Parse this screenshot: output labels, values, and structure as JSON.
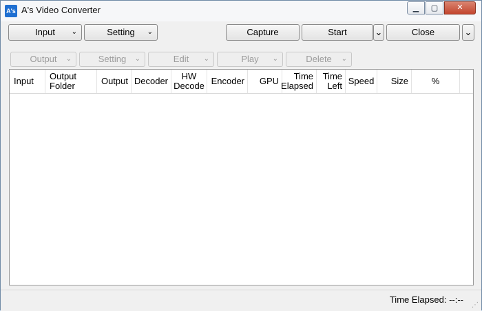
{
  "window": {
    "title": "A's Video Converter",
    "icon_label": "A's",
    "caption": {
      "minimize": "▁",
      "maximize": "▢",
      "close": "✕"
    }
  },
  "toolbar": {
    "input_label": "Input",
    "setting_label": "Setting",
    "capture_label": "Capture",
    "start_label": "Start",
    "close_label": "Close"
  },
  "subtoolbar": {
    "items": [
      {
        "label": "Output"
      },
      {
        "label": "Setting"
      },
      {
        "label": "Edit"
      },
      {
        "label": "Play"
      },
      {
        "label": "Delete"
      }
    ]
  },
  "table": {
    "columns": {
      "input": "Input",
      "output_folder": "Output Folder",
      "output": "Output",
      "decoder": "Decoder",
      "hw_decode": "HW Decode",
      "encoder": "Encoder",
      "gpu": "GPU",
      "time_elapsed": "Time Elapsed",
      "time_left": "Time Left",
      "speed": "Speed",
      "size": "Size",
      "percent": "%"
    },
    "rows": []
  },
  "statusbar": {
    "time_elapsed_text": "Time Elapsed: --:--"
  },
  "icons": {
    "chevron": "chevron-down-icon",
    "app": "app-icon"
  }
}
